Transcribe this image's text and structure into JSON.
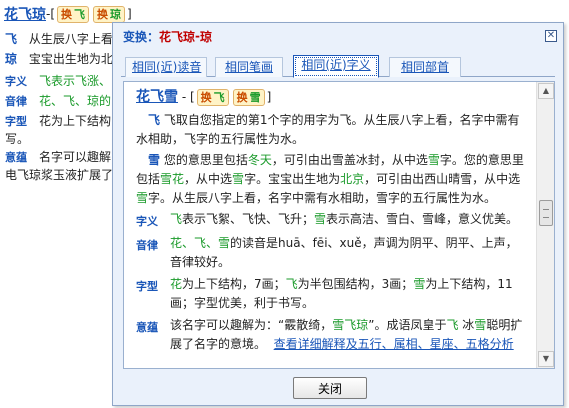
{
  "background": {
    "title_name": "花飞琼",
    "title_sep": " - ",
    "chip1": {
      "a": "换",
      "b": "飞"
    },
    "chip2": {
      "a": "换",
      "b": "琼"
    },
    "lines": [
      {
        "label": "飞",
        "text": "从生辰八字上看"
      },
      {
        "label": "琼",
        "text": "宝宝出生地为北"
      },
      {
        "label": "字义",
        "text": "飞表示飞涨、"
      },
      {
        "label": "音律",
        "text": "花、飞、琼的"
      },
      {
        "label": "字型",
        "text": "花为上下结构"
      },
      {
        "label": "",
        "text": "写。"
      },
      {
        "label": "意蕴",
        "text": "名字可以趣解"
      },
      {
        "label": "",
        "text": "电飞琼浆玉液扩展了"
      }
    ]
  },
  "dialog": {
    "title_prefix": "变换：",
    "title_name": "花飞琼",
    "title_sep": " - ",
    "title_target": "琼",
    "close_x": "✕",
    "tabs": [
      "相同(近)读音",
      "相同笔画",
      "相同(近)字义",
      "相同部首"
    ],
    "active_tab": 2,
    "close_button": "关闭"
  },
  "panel": {
    "name": "花飞雪",
    "chip1": {
      "a": "换",
      "b": "飞"
    },
    "chip2": {
      "a": "换",
      "b": "雪"
    },
    "para1": {
      "c": "飞",
      "t": "飞取自您指定的第1个字的用字为飞。从生辰八字上看，名字中需有水相助，飞字的五行属性为水。"
    },
    "para2": {
      "c": "雪",
      "t1": "您的意思里包括",
      "g1": "冬天",
      "t2": "，可引由出雪盖冰封，从中选",
      "g2": "雪",
      "t3": "字。您的意思里包括",
      "g3": "雪花",
      "t4": "，从中选",
      "g4": "雪",
      "t5": "字。宝宝出生地为",
      "g5": "北京",
      "t6": "，可引由出西山晴雪，从中选",
      "g6": "雪",
      "t7": "字。从生辰八字上看，名字中需有水相助，雪字的五行属性为水。"
    },
    "ziyi": {
      "label": "字义",
      "g1": "飞",
      "t1": "表示飞絮、飞快、飞升；",
      "g2": "雪",
      "t2": "表示高洁、雪白、雪峰，意义优美。"
    },
    "yinlv": {
      "label": "音律",
      "g": "花、飞、雪",
      "t": "的读音是huā、fēi、xuě，声调为阴平、阴平、上声，音律较好。"
    },
    "zixing": {
      "label": "字型",
      "g1": "花",
      "t1": "为上下结构，7画；",
      "g2": "飞",
      "t2": "为半包围结构，3画；",
      "g3": "雪",
      "t3": "为上下结构，11画；字型优美，利于书写。"
    },
    "yiyun": {
      "label": "意蕴",
      "t1": "该名字可以趣解为：“霰散绮，",
      "g1": "雪飞琼",
      "t2": "”。成语凤皇于",
      "g2": "飞",
      "t3": " 冰",
      "g3": "雪",
      "t4": "聪明扩展了名字的意境。",
      "link": "查看详细解释及五行、属相、星座、五格分析"
    }
  },
  "colors": {
    "accent_blue": "#1a56b8",
    "green": "#1a9a2a",
    "red": "#c00000",
    "dialog_bg": "#eaf1fb"
  }
}
